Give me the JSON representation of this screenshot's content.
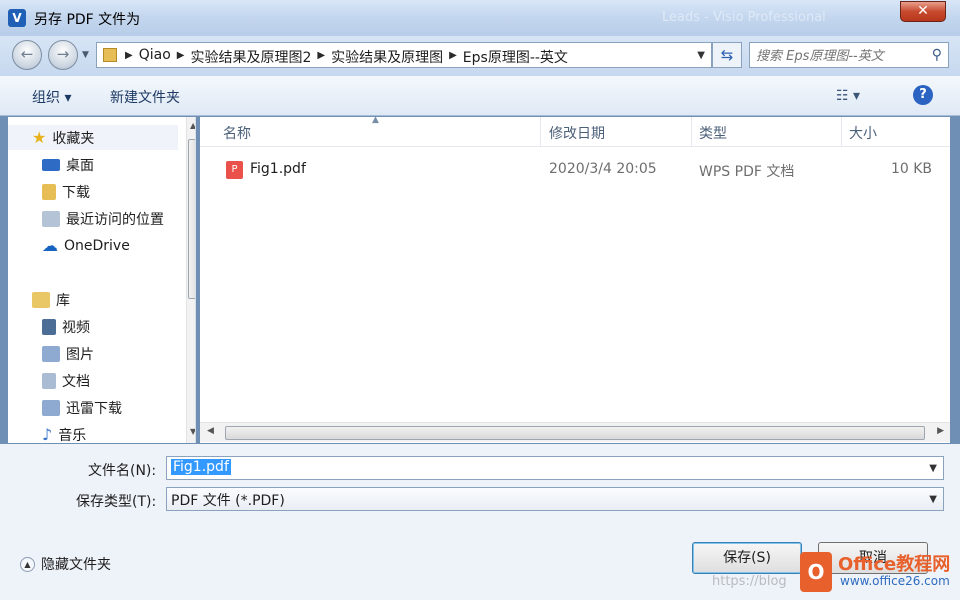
{
  "window": {
    "title": "另存 PDF 文件为",
    "app_icon_letter": "V",
    "background_ghost_text": "Leads - Visio Professional",
    "close_label": "✕"
  },
  "nav": {
    "breadcrumbs": [
      "Qiao",
      "实验结果及原理图2",
      "实验结果及原理图",
      "Eps原理图--英文"
    ],
    "search_placeholder": "搜索 Eps原理图--英文"
  },
  "toolbar": {
    "organize_label": "组织 ▾",
    "new_folder_label": "新建文件夹"
  },
  "sidebar": {
    "items": [
      {
        "label": "收藏夹",
        "icon": "star-icon",
        "color": "#e8b21c",
        "indent": false
      },
      {
        "label": "桌面",
        "icon": "desktop-icon",
        "color": "#2e6bc4",
        "indent": true
      },
      {
        "label": "下载",
        "icon": "downloads-icon",
        "color": "#3a74c9",
        "indent": true
      },
      {
        "label": "最近访问的位置",
        "icon": "recent-places-icon",
        "color": "#8aa0b8",
        "indent": true
      },
      {
        "label": "OneDrive",
        "icon": "onedrive-icon",
        "color": "#1763c2",
        "indent": true
      },
      {
        "label": "库",
        "icon": "library-icon",
        "color": "#d9a93a",
        "indent": false
      },
      {
        "label": "视频",
        "icon": "video-icon",
        "color": "#4b6d96",
        "indent": true
      },
      {
        "label": "图片",
        "icon": "pictures-icon",
        "color": "#6d8db3",
        "indent": true
      },
      {
        "label": "文档",
        "icon": "documents-icon",
        "color": "#7c96b8",
        "indent": true
      },
      {
        "label": "迅雷下载",
        "icon": "thunder-download-icon",
        "color": "#6d8db3",
        "indent": true
      },
      {
        "label": "音乐",
        "icon": "music-icon",
        "color": "#3a74c9",
        "indent": true
      }
    ]
  },
  "columns": {
    "name": "名称",
    "modified": "修改日期",
    "type": "类型",
    "size": "大小"
  },
  "files": [
    {
      "name": "Fig1.pdf",
      "modified": "2020/3/4 20:05",
      "type": "WPS PDF 文档",
      "size": "10 KB"
    }
  ],
  "form": {
    "filename_label": "文件名(N):",
    "filename_value": "Fig1.pdf",
    "savetype_label": "保存类型(T):",
    "savetype_value": "PDF 文件 (*.PDF)"
  },
  "footer": {
    "hide_folders_label": "隐藏文件夹",
    "save_label": "保存(S)",
    "cancel_label": "取消"
  },
  "watermark": {
    "brand": "Office教程网",
    "url": "www.office26.com",
    "blog": "https://blog"
  }
}
